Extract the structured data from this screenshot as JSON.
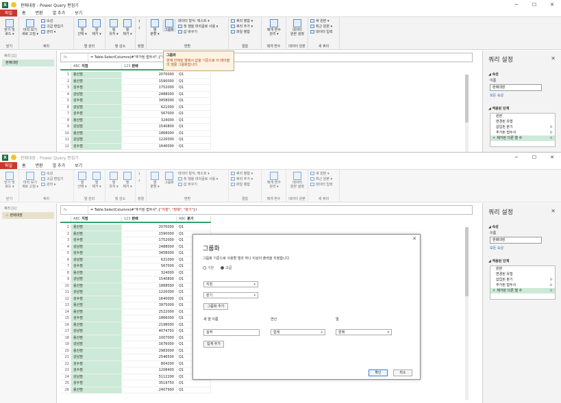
{
  "app": {
    "title": "판매대장 - Power Query 편집기",
    "title_bottom": "판매대장 - Power Query 편집기",
    "excel_icon": "X"
  },
  "tabs": [
    "파일",
    "홈",
    "변환",
    "열 추가",
    "보기"
  ],
  "ribbon": {
    "close_load": "닫기 및\n로드 ▾",
    "close_group": "닫기",
    "refresh": "미리 보기\n새로 고침 ▾",
    "properties": "속성",
    "advanced_editor": "고급 편집기",
    "manage": "관리 ▾",
    "query_group": "쿼리",
    "choose_columns": "열\n선택 ▾",
    "remove_columns": "열\n제거 ▾",
    "column_mgmt_group": "열 관리",
    "keep_rows": "행\n유지 ▾",
    "remove_rows": "행\n제거 ▾",
    "row_reduce_group": "행 감소",
    "sort_group": "정렬",
    "split_column": "열\n분할 ▾",
    "group_by": "그룹화",
    "data_type": "데이터 형식: 텍스트 ▾",
    "use_first_row": "첫 행을 머리글로 사용 ▾",
    "replace_values": "값 바꾸기",
    "transform_group": "변환",
    "merge_queries": "쿼리 병합 ▾",
    "append_queries": "쿼리 추가 ▾",
    "combine_files": "파일 병합",
    "combine_group": "결합",
    "manage_params": "매개 변수\n관리 ▾",
    "params_group": "매개 변수",
    "data_source_settings": "데이터\n원본 설정",
    "data_source_group": "데이터 원본",
    "new_source": "새 원본 ▾",
    "recent_sources": "최근 원본 ▾",
    "enter_data": "데이터 입력",
    "new_query_group": "새 쿼리"
  },
  "queries": {
    "header": "쿼리 [1]",
    "item": "판매대장"
  },
  "formula": {
    "fx": "fx",
    "top": "= Table.SelectColumns(#\"추가된 접두사\",{\"지점\", \"판매\", \"분기\"})",
    "bottom_prefix": "= Table.SelectColumns(#\"추가된 접두사\",{",
    "bottom_a": "\"지점\"",
    "bottom_sep1": ", ",
    "bottom_b": "\"판매\"",
    "bottom_sep2": ", ",
    "bottom_c": "\"분기\"",
    "bottom_suffix": "})"
  },
  "grid": {
    "headers": [
      "지점",
      "판매",
      "분기"
    ],
    "header_types": [
      "ABC",
      "123",
      "ABC"
    ],
    "rows_top": [
      [
        "1",
        "용산점",
        "2070000",
        "Q1"
      ],
      [
        "2",
        "용산점",
        "1590000",
        "Q1"
      ],
      [
        "3",
        "성수점",
        "1752000",
        "Q1"
      ],
      [
        "4",
        "강남점",
        "2488000",
        "Q1"
      ],
      [
        "5",
        "성수점",
        "3458000",
        "Q1"
      ],
      [
        "6",
        "강남점",
        "621000",
        "Q1"
      ],
      [
        "7",
        "성수점",
        "567000",
        "Q1"
      ],
      [
        "8",
        "용산점",
        "324000",
        "Q1"
      ],
      [
        "9",
        "강남점",
        "1540800",
        "Q1"
      ],
      [
        "10",
        "용산점",
        "1868000",
        "Q1"
      ],
      [
        "11",
        "강남점",
        "1220000",
        "Q1"
      ],
      [
        "12",
        "성수점",
        "1640000",
        "Q1"
      ]
    ],
    "rows_bottom": [
      [
        "1",
        "용산점",
        "2070000",
        "Q1"
      ],
      [
        "2",
        "용산점",
        "1590000",
        "Q1"
      ],
      [
        "3",
        "성수점",
        "1752000",
        "Q1"
      ],
      [
        "4",
        "강남점",
        "2488000",
        "Q1"
      ],
      [
        "5",
        "성수점",
        "3458000",
        "Q1"
      ],
      [
        "6",
        "강남점",
        "621000",
        "Q1"
      ],
      [
        "7",
        "성수점",
        "567000",
        "Q1"
      ],
      [
        "8",
        "용산점",
        "324000",
        "Q1"
      ],
      [
        "9",
        "강남점",
        "1540800",
        "Q1"
      ],
      [
        "10",
        "용산점",
        "1868000",
        "Q1"
      ],
      [
        "11",
        "강남점",
        "1220000",
        "Q1"
      ],
      [
        "12",
        "성수점",
        "1640000",
        "Q1"
      ],
      [
        "13",
        "용산점",
        "3975000",
        "Q1"
      ],
      [
        "14",
        "용산점",
        "2522000",
        "Q1"
      ],
      [
        "15",
        "성수점",
        "1866000",
        "Q1"
      ],
      [
        "16",
        "용산점",
        "2198000",
        "Q1"
      ],
      [
        "17",
        "강남점",
        "4074750",
        "Q1"
      ],
      [
        "18",
        "용산점",
        "1007000",
        "Q1"
      ],
      [
        "19",
        "강남점",
        "1676000",
        "Q1"
      ],
      [
        "20",
        "용산점",
        "2983000",
        "Q1"
      ],
      [
        "21",
        "강남점",
        "2546500",
        "Q1"
      ],
      [
        "22",
        "성수점",
        "804200",
        "Q1"
      ],
      [
        "23",
        "성수점",
        "1208400",
        "Q1"
      ],
      [
        "24",
        "강남점",
        "5112200",
        "Q1"
      ],
      [
        "25",
        "성수점",
        "3519750",
        "Q1"
      ],
      [
        "26",
        "용산점",
        "2407900",
        "Q1"
      ]
    ]
  },
  "settings": {
    "title": "쿼리 설정",
    "properties": "◢ 속성",
    "name_label": "이름",
    "name_value": "판매대장",
    "all_properties": "모든 속성",
    "applied_steps": "◢ 적용된 단계",
    "steps": [
      "원본",
      "변경된 유형",
      "삽입된 분기",
      "추가된 접두사",
      "제거된 다른 열 수"
    ]
  },
  "tooltip": {
    "title": "그룹화",
    "body": "현재 선택된 열에서 값을 기준으로 이 테이블의 행을 그룹화합니다."
  },
  "dialog": {
    "title": "그룹화",
    "description": "그룹화 기준으로 사용할 열과 하나 이상의 출력을 지정합니다.",
    "radio_basic": "기본",
    "radio_advanced": "고급",
    "group_col_1": "지점",
    "group_col_2": "분기",
    "add_grouping": "그룹화 추가",
    "new_col_label": "새 열 이름",
    "operation_label": "연산",
    "column_label": "열",
    "new_col_value": "실적",
    "operation_value": "합계",
    "column_value": "판매",
    "add_aggregation": "집계 추가",
    "ok": "확인",
    "cancel": "취소"
  }
}
